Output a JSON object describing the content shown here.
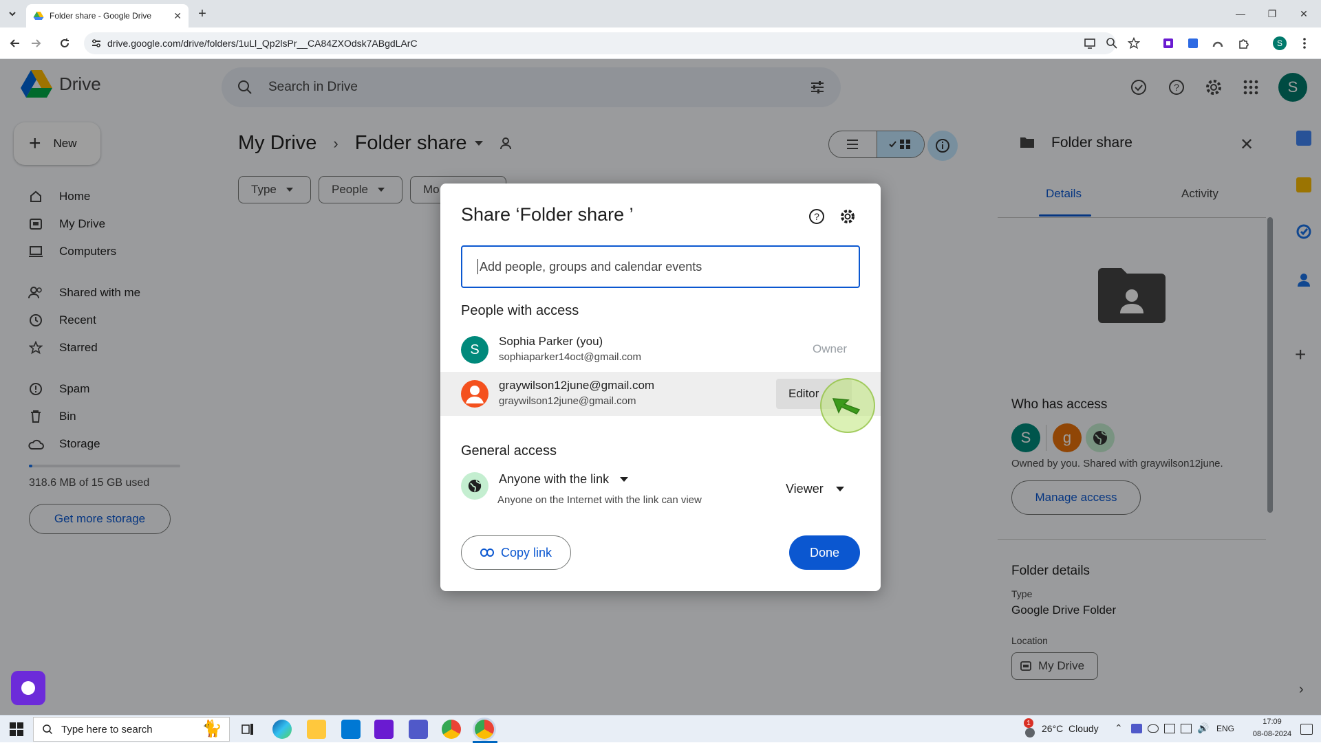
{
  "browser": {
    "tab_title": "Folder share - Google Drive",
    "url": "drive.google.com/drive/folders/1uLl_Qp2lsPr__CA84ZXOdsk7ABgdLArC"
  },
  "drive": {
    "app_name": "Drive",
    "search_placeholder": "Search in Drive",
    "new_label": "New",
    "nav": [
      {
        "label": "Home",
        "icon": "home-icon"
      },
      {
        "label": "My Drive",
        "icon": "my-drive-icon"
      },
      {
        "label": "Computers",
        "icon": "computer-icon"
      },
      {
        "label": "Shared with me",
        "icon": "people-icon"
      },
      {
        "label": "Recent",
        "icon": "clock-icon"
      },
      {
        "label": "Starred",
        "icon": "star-icon"
      },
      {
        "label": "Spam",
        "icon": "spam-icon"
      },
      {
        "label": "Bin",
        "icon": "bin-icon"
      },
      {
        "label": "Storage",
        "icon": "cloud-icon"
      }
    ],
    "storage_text": "318.6 MB of 15 GB used",
    "storage_fraction": 0.021,
    "get_storage": "Get more storage",
    "breadcrumb_root": "My Drive",
    "breadcrumb_current": "Folder share",
    "filters": [
      "Type",
      "People",
      "Mo"
    ],
    "avatar_letter": "S"
  },
  "details": {
    "title": "Folder share",
    "tabs": [
      "Details",
      "Activity"
    ],
    "who_has_access": "Who has access",
    "owned_text": "Owned by you. Shared with graywilson12june.",
    "manage_access": "Manage access",
    "folder_details": "Folder details",
    "type_label": "Type",
    "type_value": "Google Drive Folder",
    "location_label": "Location",
    "location_value": "My Drive",
    "access_avatars": [
      "S",
      "g"
    ]
  },
  "dialog": {
    "title": "Share ‘Folder share ’",
    "input_placeholder": "Add people, groups and calendar events",
    "people_heading": "People with access",
    "people": [
      {
        "avatar": "S",
        "name": "Sophia Parker (you)",
        "email": "sophiaparker14oct@gmail.com",
        "role": "Owner"
      },
      {
        "avatar": "",
        "name": "graywilson12june@gmail.com",
        "email": "graywilson12june@gmail.com",
        "role": "Editor"
      }
    ],
    "general_heading": "General access",
    "access_scope": "Anyone with the link",
    "access_desc": "Anyone on the Internet with the link can view",
    "access_role": "Viewer",
    "copy_link": "Copy link",
    "done": "Done"
  },
  "taskbar": {
    "search_placeholder": "Type here to search",
    "weather": "26°C  Cloudy",
    "language": "ENG",
    "time": "17:09",
    "date": "08-08-2024",
    "notification_count": "1"
  },
  "colors": {
    "accent": "#0b57d0",
    "owner_avatar": "#00897b",
    "editor_avatar": "#f4511e"
  }
}
